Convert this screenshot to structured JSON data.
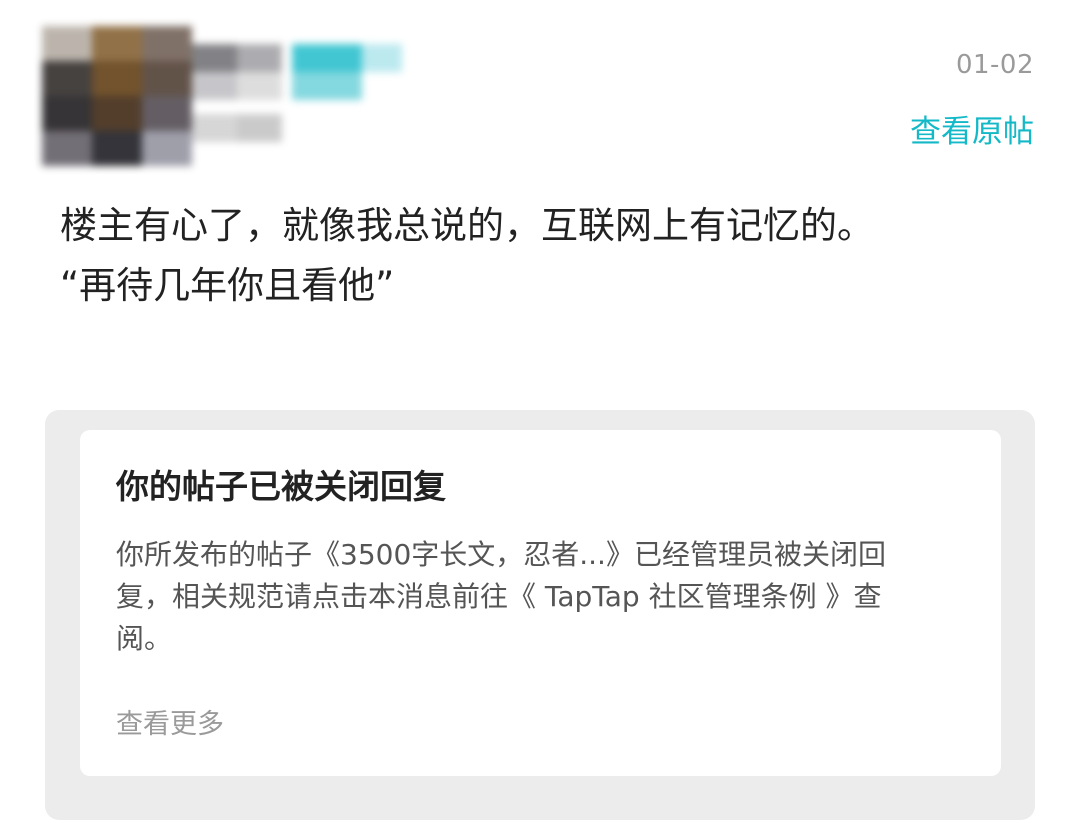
{
  "post": {
    "date": "01-02",
    "view_original_label": "查看原帖",
    "comment_lines": [
      "楼主有心了，就像我总说的，互联网上有记忆的。",
      "“再待几年你且看他”"
    ]
  },
  "notice": {
    "title": "你的帖子已被关闭回复",
    "body_lines": [
      "你所发布的帖子《3500字长文，忍者...》已经管理员被关闭回",
      "复，相关规范请点击本消息前往《 TapTap 社区管理条例 》查",
      "阅。"
    ],
    "more_label": "查看更多"
  },
  "colors": {
    "accent": "#14b9c8",
    "muted_text": "#9a9a9a",
    "card_bg": "#ececec"
  }
}
